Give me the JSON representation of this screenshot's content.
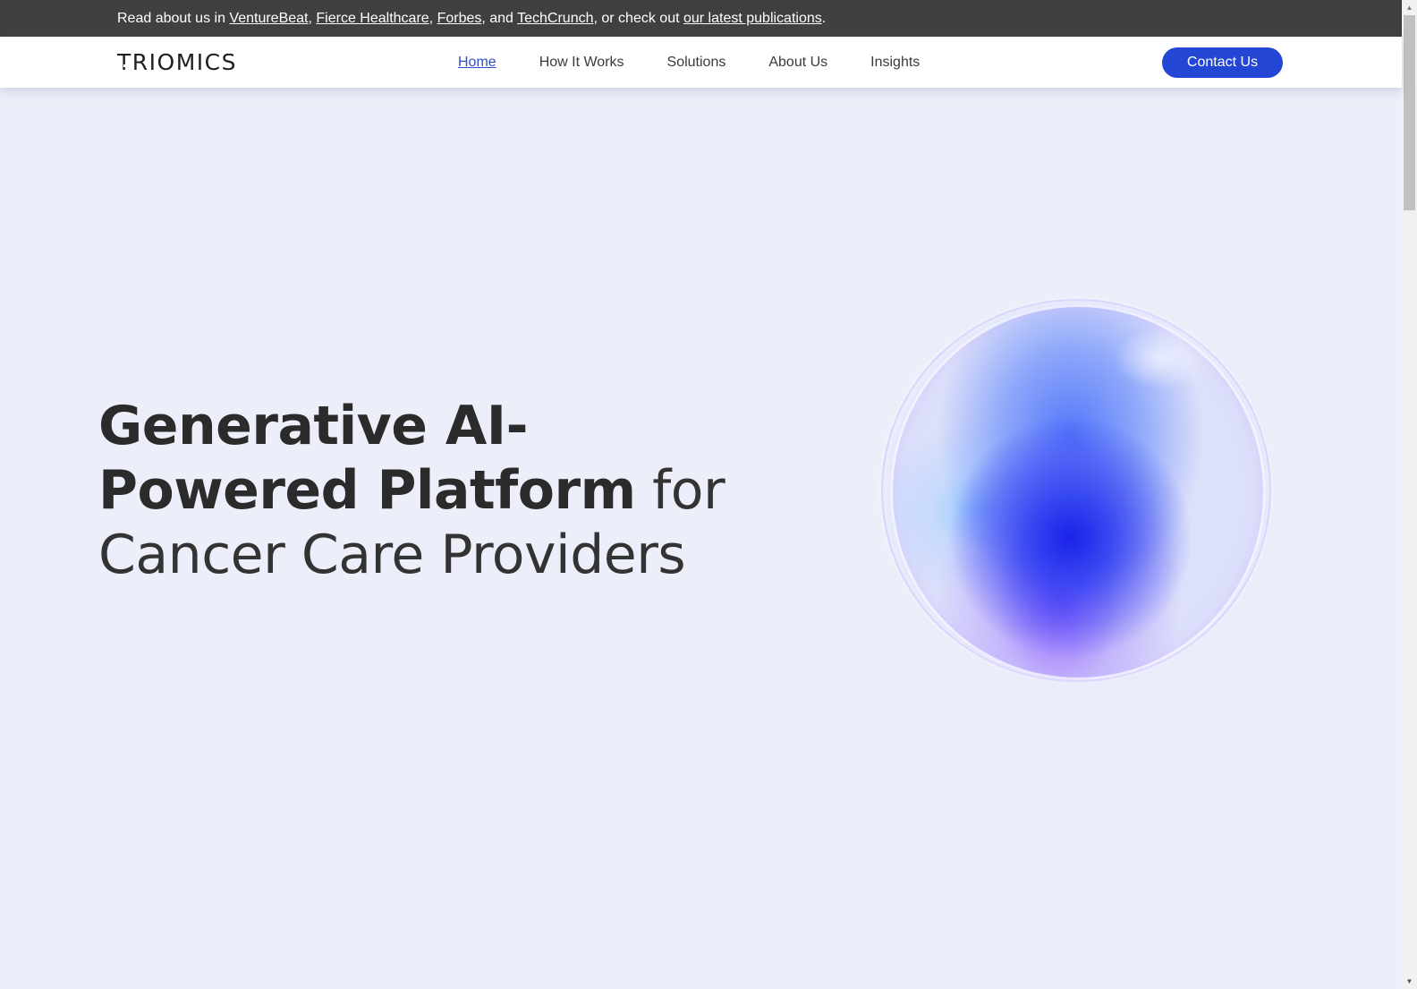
{
  "announcement": {
    "prefix": "Read about us in ",
    "links": [
      "VentureBeat",
      "Fierce Healthcare",
      "Forbes",
      "TechCrunch"
    ],
    "sep1": ", ",
    "sep2": ", ",
    "sep3": ", and ",
    "middle": ", or check out ",
    "publications_link": "our latest publications",
    "suffix": "."
  },
  "nav": {
    "logo_first": "T",
    "logo_rest": "RIOMICS",
    "links": [
      {
        "label": "Home",
        "active": true
      },
      {
        "label": "How It Works"
      },
      {
        "label": "Solutions"
      },
      {
        "label": "About Us"
      },
      {
        "label": "Insights"
      }
    ],
    "cta": "Contact Us"
  },
  "hero": {
    "title_bold": "Generative AI-Powered Platform",
    "title_light": " for Cancer Care Providers"
  },
  "colors": {
    "announcement_bg": "#404040",
    "accent": "#2347d4",
    "active_link": "#2f4fc4",
    "page_bg": "#eceef9"
  },
  "icons": {
    "scroll_up": "▲",
    "scroll_down": "▼"
  }
}
